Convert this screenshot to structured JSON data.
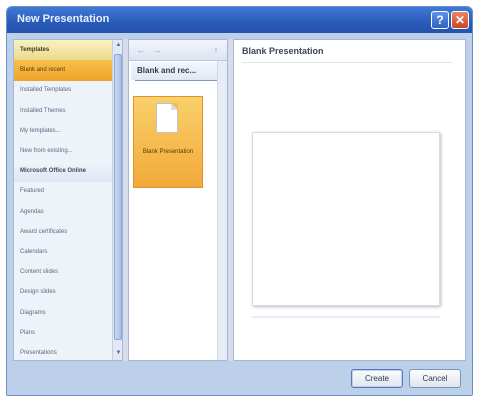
{
  "window": {
    "title": "New Presentation"
  },
  "titlebar": {
    "help_glyph": "?",
    "close_glyph": "✕"
  },
  "sidebar": {
    "items": [
      {
        "label": "Templates",
        "kind": "header"
      },
      {
        "label": "Blank and recent",
        "kind": "selected"
      },
      {
        "label": "Installed Templates",
        "kind": "item"
      },
      {
        "label": "Installed Themes",
        "kind": "item"
      },
      {
        "label": "My templates...",
        "kind": "item"
      },
      {
        "label": "New from existing...",
        "kind": "item"
      },
      {
        "label": "Microsoft Office Online",
        "kind": "section"
      },
      {
        "label": "Featured",
        "kind": "item"
      },
      {
        "label": "Agendas",
        "kind": "item"
      },
      {
        "label": "Award certificates",
        "kind": "item"
      },
      {
        "label": "Calendars",
        "kind": "item"
      },
      {
        "label": "Content slides",
        "kind": "item"
      },
      {
        "label": "Design slides",
        "kind": "item"
      },
      {
        "label": "Diagrams",
        "kind": "item"
      },
      {
        "label": "Plans",
        "kind": "item"
      },
      {
        "label": "Presentations",
        "kind": "item"
      }
    ]
  },
  "middle": {
    "nav": {
      "back": "←",
      "forward": "→",
      "up": "↑"
    },
    "heading": "Blank and rec...",
    "tile_label": "Blank Presentation"
  },
  "preview": {
    "title": "Blank Presentation"
  },
  "footer": {
    "create_label": "Create",
    "cancel_label": "Cancel"
  },
  "colors": {
    "titlebar": "#2a5bb8",
    "selection": "#f2a93a",
    "header": "#ecd98a",
    "dialog_bg": "#d6dcea"
  }
}
